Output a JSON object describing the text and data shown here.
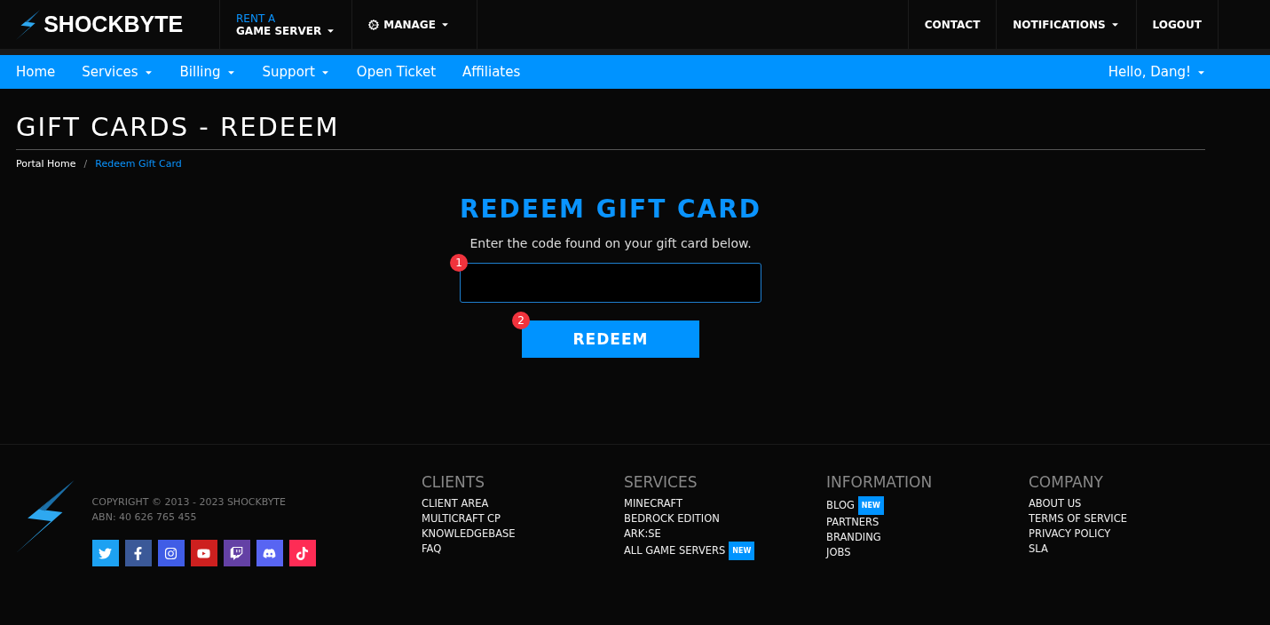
{
  "topbar": {
    "brand": "SHOCKBYTE",
    "rent": {
      "small": "RENT A",
      "big": "GAME SERVER"
    },
    "manage": "MANAGE",
    "right": [
      {
        "label": "CONTACT",
        "caret": false
      },
      {
        "label": "NOTIFICATIONS",
        "caret": true
      },
      {
        "label": "LOGOUT",
        "caret": false
      }
    ]
  },
  "nav": {
    "items": [
      {
        "label": "Home",
        "caret": false
      },
      {
        "label": "Services",
        "caret": true
      },
      {
        "label": "Billing",
        "caret": true
      },
      {
        "label": "Support",
        "caret": true
      },
      {
        "label": "Open Ticket",
        "caret": false
      },
      {
        "label": "Affiliates",
        "caret": false
      }
    ],
    "user": {
      "label": "Hello, Dang!",
      "caret": true
    }
  },
  "page": {
    "title": "GIFT CARDS - REDEEM",
    "breadcrumb": [
      {
        "label": "Portal Home",
        "selected": false
      },
      {
        "label": "/",
        "kind": "sep"
      },
      {
        "label": "Redeem Gift Card",
        "selected": true
      }
    ]
  },
  "redeem": {
    "heading": "REDEEM GIFT CARD",
    "text": "Enter the code found on your gift card below.",
    "field_marker": "1",
    "button": "REDEEM",
    "button_marker": "2"
  },
  "footer": {
    "copyright": "COPYRIGHT © 2013 - 2023 SHOCKBYTE",
    "abn": "ABN: 40 626 765 455",
    "social": [
      {
        "kind": "twitter",
        "color": "#1da1f2"
      },
      {
        "kind": "facebook",
        "color": "#3b5998"
      },
      {
        "kind": "instagram",
        "color": "#405de6"
      },
      {
        "kind": "youtube",
        "color": "#cd201f"
      },
      {
        "kind": "twitch",
        "color": "#6441a5"
      },
      {
        "kind": "discord",
        "color": "#5865f2"
      },
      {
        "kind": "tiktok",
        "color": "#fe2c55"
      }
    ],
    "columns": [
      {
        "title": "CLIENTS",
        "links": [
          {
            "label": "CLIENT AREA"
          },
          {
            "label": "MULTICRAFT CP"
          },
          {
            "label": "KNOWLEDGEBASE"
          },
          {
            "label": "FAQ"
          }
        ]
      },
      {
        "title": "SERVICES",
        "links": [
          {
            "label": "MINECRAFT"
          },
          {
            "label": "BEDROCK EDITION"
          },
          {
            "label": "ARK:SE"
          },
          {
            "label": "ALL GAME SERVERS",
            "badge": "NEW"
          }
        ]
      },
      {
        "title": "INFORMATION",
        "links": [
          {
            "label": "BLOG",
            "badge": "NEW"
          },
          {
            "label": "PARTNERS"
          },
          {
            "label": "BRANDING"
          },
          {
            "label": "JOBS"
          }
        ]
      },
      {
        "title": "COMPANY",
        "links": [
          {
            "label": "ABOUT US"
          },
          {
            "label": "TERMS OF SERVICE"
          },
          {
            "label": "PRIVACY POLICY"
          },
          {
            "label": "SLA"
          }
        ]
      }
    ]
  }
}
